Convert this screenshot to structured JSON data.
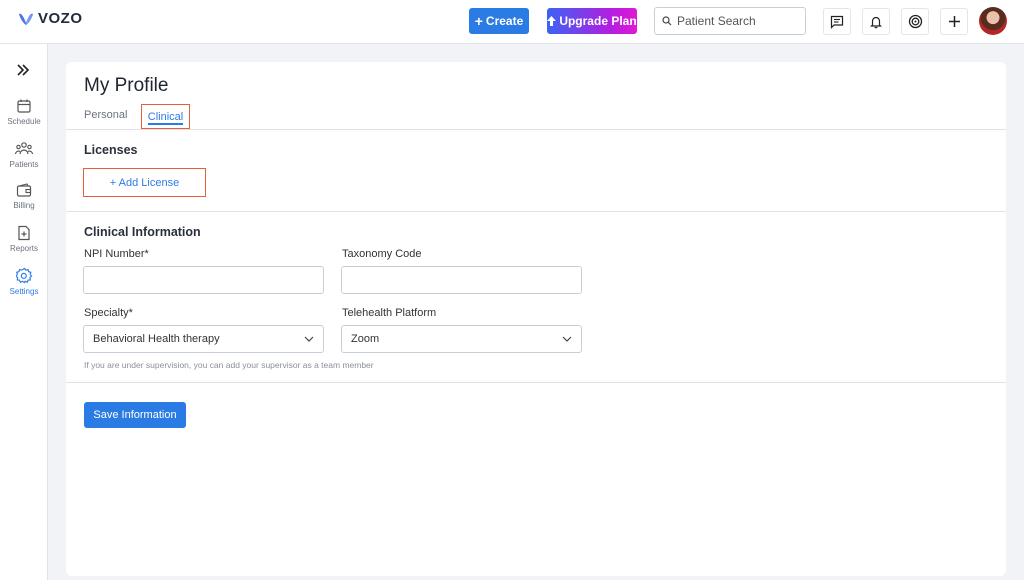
{
  "app": {
    "brand": "VOZO"
  },
  "topbar": {
    "create_label": "Create",
    "upgrade_label": "Upgrade Plan",
    "search_placeholder": "Patient Search",
    "icons": [
      "chat-icon",
      "bell-icon",
      "support-icon",
      "plus-icon"
    ]
  },
  "sidebar": {
    "items": [
      {
        "label": "Schedule",
        "icon": "calendar-icon",
        "active": false
      },
      {
        "label": "Patients",
        "icon": "users-icon",
        "active": false
      },
      {
        "label": "Billing",
        "icon": "wallet-icon",
        "active": false
      },
      {
        "label": "Reports",
        "icon": "report-icon",
        "active": false
      },
      {
        "label": "Settings",
        "icon": "gear-icon",
        "active": true
      }
    ]
  },
  "page": {
    "title": "My Profile",
    "tabs": [
      {
        "label": "Personal",
        "active": false
      },
      {
        "label": "Clinical",
        "active": true
      }
    ]
  },
  "licenses": {
    "title": "Licenses",
    "add_label": "+ Add License"
  },
  "clinical": {
    "title": "Clinical Information",
    "npi_label": "NPI Number*",
    "npi_value": "",
    "taxonomy_label": "Taxonomy Code",
    "taxonomy_value": "",
    "specialty_label": "Specialty*",
    "specialty_value": "Behavioral Health therapy",
    "telehealth_label": "Telehealth Platform",
    "telehealth_value": "Zoom",
    "hint": "If you are under supervision, you can add your supervisor as a team member"
  },
  "save_label": "Save Information",
  "colors": {
    "accent": "#2b7be4",
    "highlight": "#e5603a"
  }
}
